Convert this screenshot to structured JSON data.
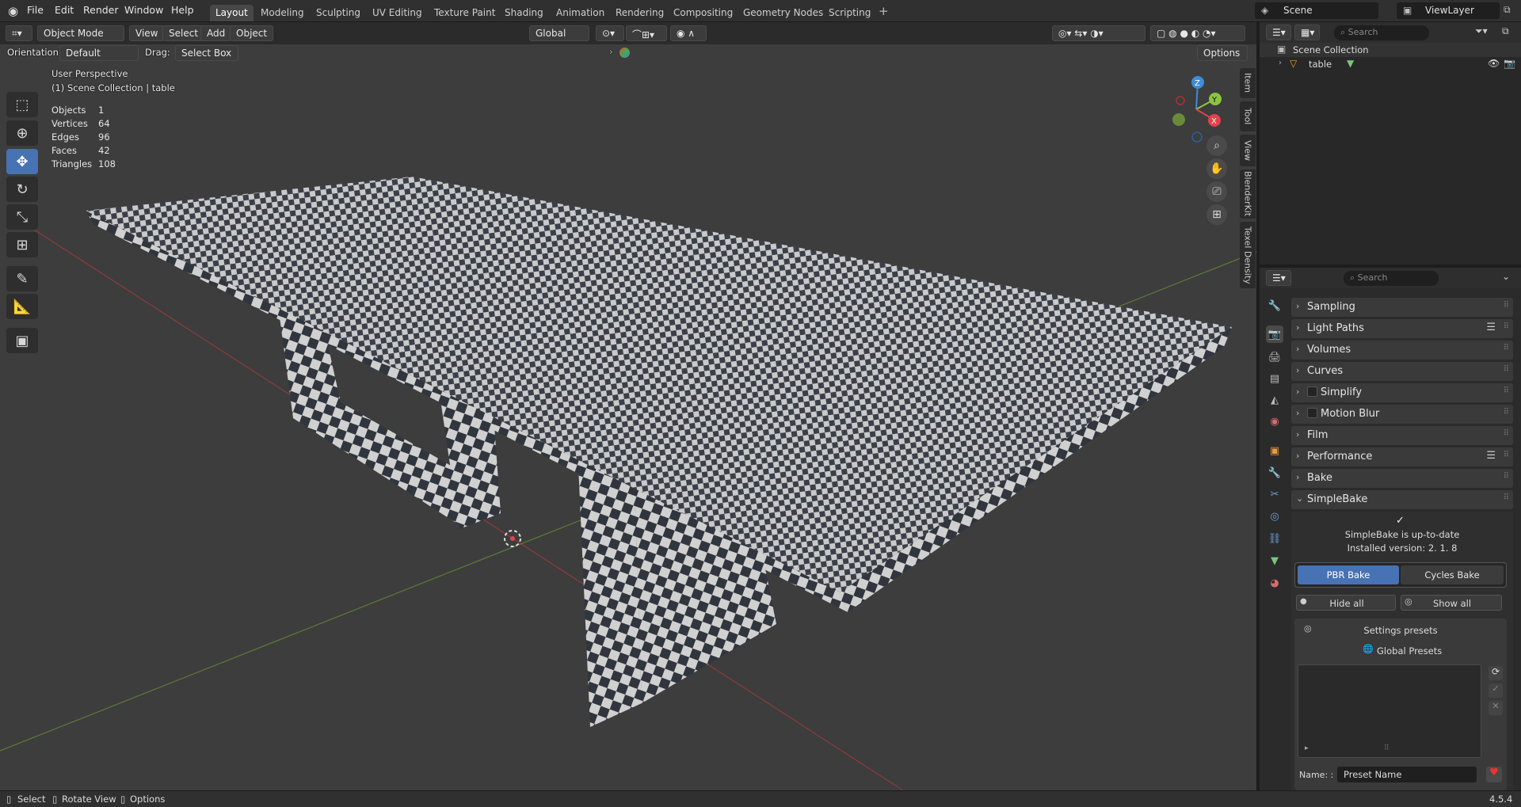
{
  "menubar": {
    "items": [
      "File",
      "Edit",
      "Render",
      "Window",
      "Help"
    ]
  },
  "workspaces": [
    "Layout",
    "Modeling",
    "Sculpting",
    "UV Editing",
    "Texture Paint",
    "Shading",
    "Animation",
    "Rendering",
    "Compositing",
    "Geometry Nodes",
    "Scripting"
  ],
  "scene": {
    "scene_name": "Scene",
    "view_layer": "ViewLayer"
  },
  "viewport_header": {
    "mode": "Object Mode",
    "view": "View",
    "select": "Select",
    "add": "Add",
    "object": "Object",
    "transform": "Global",
    "options": "Options"
  },
  "viewport_sub": {
    "orientation_label": "Orientation:",
    "orientation_value": "Default",
    "drag_label": "Drag:",
    "drag_value": "Select Box"
  },
  "overlay": {
    "perspective": "User Perspective",
    "collection": "(1) Scene Collection | table",
    "stats": [
      {
        "label": "Objects",
        "value": "1"
      },
      {
        "label": "Vertices",
        "value": "64"
      },
      {
        "label": "Edges",
        "value": "96"
      },
      {
        "label": "Faces",
        "value": "42"
      },
      {
        "label": "Triangles",
        "value": "108"
      }
    ]
  },
  "gizmo": {
    "x": "X",
    "y": "Y",
    "z": "Z"
  },
  "n_tabs": [
    "Item",
    "Tool",
    "View",
    "BlenderKit",
    "Texel Density"
  ],
  "outliner": {
    "search_placeholder": "Search",
    "root": "Scene Collection",
    "items": [
      {
        "name": "table"
      }
    ]
  },
  "properties": {
    "search_placeholder": "Search",
    "panels": [
      "Sampling",
      "Light Paths",
      "Volumes",
      "Curves",
      "Simplify",
      "Motion Blur",
      "Film",
      "Performance",
      "Bake",
      "SimpleBake"
    ],
    "simplebake": {
      "status": "SimpleBake is up-to-date",
      "version": "Installed version: 2. 1. 8",
      "pbr_bake": "PBR Bake",
      "cycles_bake": "Cycles Bake",
      "hide_all": "Hide all",
      "show_all": "Show all",
      "settings_presets": "Settings presets",
      "global_presets": "Global Presets",
      "name_label": "Name: :",
      "name_value": "Preset Name"
    }
  },
  "statusbar": {
    "select": "Select",
    "rotate": "Rotate View",
    "options": "Options",
    "version": "4.5.4"
  },
  "colors": {
    "accent": "#4772b3",
    "x_axis": "#e2424e",
    "y_axis": "#8bc53f",
    "z_axis": "#3d8cd8"
  }
}
